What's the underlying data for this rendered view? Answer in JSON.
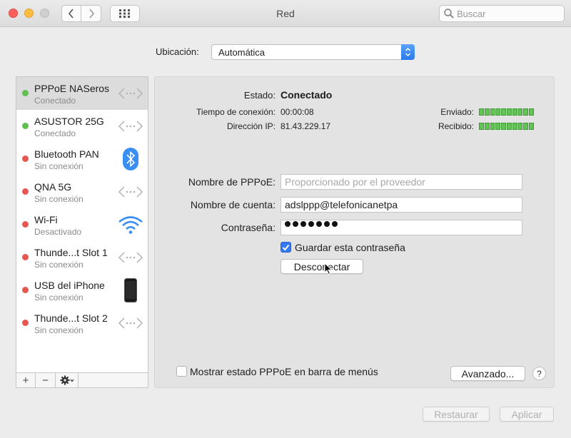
{
  "window": {
    "title": "Red",
    "search_placeholder": "Buscar"
  },
  "location": {
    "label": "Ubicación:",
    "value": "Automática"
  },
  "services": [
    {
      "name": "PPPoE NASeros",
      "status": "Conectado",
      "status_color": "#5fc04f",
      "icon": "ethernet-arrows-icon",
      "selected": true
    },
    {
      "name": "ASUSTOR 25G",
      "status": "Conectado",
      "status_color": "#5fc04f",
      "icon": "ethernet-arrows-icon"
    },
    {
      "name": "Bluetooth PAN",
      "status": "Sin conexión",
      "status_color": "#e8574f",
      "icon": "bluetooth-icon"
    },
    {
      "name": "QNA 5G",
      "status": "Sin conexión",
      "status_color": "#e8574f",
      "icon": "ethernet-arrows-icon"
    },
    {
      "name": "Wi-Fi",
      "status": "Desactivado",
      "status_color": "#e8574f",
      "icon": "wifi-icon"
    },
    {
      "name": "Thunde...t Slot  1",
      "status": "Sin conexión",
      "status_color": "#e8574f",
      "icon": "ethernet-arrows-icon"
    },
    {
      "name": "USB del iPhone",
      "status": "Sin conexión",
      "status_color": "#e8574f",
      "icon": "iphone-icon"
    },
    {
      "name": "Thunde...t Slot  2",
      "status": "Sin conexión",
      "status_color": "#e8574f",
      "icon": "ethernet-arrows-icon"
    }
  ],
  "sidebar_toolbar": {
    "add": "+",
    "remove": "−"
  },
  "detail": {
    "status_label": "Estado:",
    "status_value": "Conectado",
    "time_label": "Tiempo de conexión:",
    "time_value": "00:00:08",
    "ip_label": "Dirección IP:",
    "ip_value": "81.43.229.17",
    "sent_label": "Enviado:",
    "received_label": "Recibido:",
    "sent_level": 1.0,
    "received_level": 1.0,
    "pppoe_name_label": "Nombre de PPPoE:",
    "pppoe_name_placeholder": "Proporcionado por el proveedor",
    "account_label": "Nombre de cuenta:",
    "account_value": "adslppp@telefonicanetpa",
    "password_label": "Contraseña:",
    "password_length": 7,
    "save_password_label": "Guardar esta contraseña",
    "save_password_checked": true,
    "disconnect_label": "Desconectar",
    "show_status_label": "Mostrar estado PPPoE en barra de menús",
    "show_status_checked": false,
    "advanced_label": "Avanzado...",
    "help_label": "?"
  },
  "footer": {
    "revert_label": "Restaurar",
    "apply_label": "Aplicar"
  },
  "colors": {
    "accent": "#3478f6",
    "meter_green": "#61c455",
    "connected": "#5fc04f",
    "disconnected": "#e8574f"
  }
}
